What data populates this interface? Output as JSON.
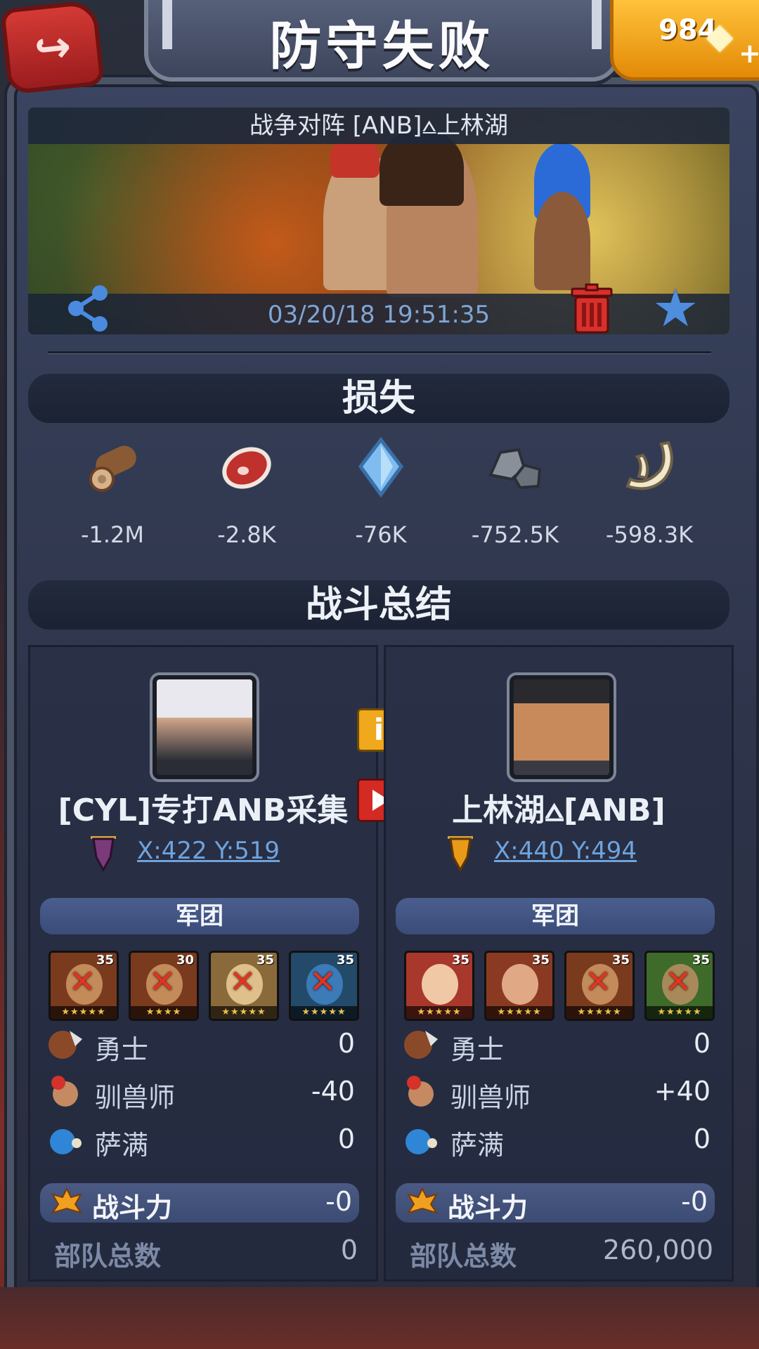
{
  "header": {
    "title": "防守失败",
    "gems": "984",
    "back_icon": "back-arrow-icon",
    "gem_icon": "diamond-icon"
  },
  "battle": {
    "title": "战争对阵 [ANB]⩟上林湖",
    "timestamp": "03/20/18 19:51:35"
  },
  "losses": {
    "title": "损失",
    "items": [
      {
        "icon": "wood-icon",
        "value": "-1.2M"
      },
      {
        "icon": "meat-icon",
        "value": "-2.8K"
      },
      {
        "icon": "crystal-icon",
        "value": "-76K"
      },
      {
        "icon": "stone-icon",
        "value": "-752.5K"
      },
      {
        "icon": "bone-icon",
        "value": "-598.3K"
      }
    ]
  },
  "summary": {
    "title": "战斗总结",
    "left": {
      "name": "[CYL]专打ANB采集",
      "coords": "X:422 Y:519",
      "legion_label": "军团",
      "heroes": [
        {
          "level": "35",
          "stars": "★★★★★",
          "defeated": true
        },
        {
          "level": "30",
          "stars": "★★★★",
          "defeated": true
        },
        {
          "level": "35",
          "stars": "★★★★★",
          "defeated": true
        },
        {
          "level": "35",
          "stars": "★★★★★",
          "defeated": true
        }
      ],
      "units": [
        {
          "name": "勇士",
          "value": "0"
        },
        {
          "name": "驯兽师",
          "value": "-40"
        },
        {
          "name": "萨满",
          "value": "0"
        }
      ],
      "power_label": "战斗力",
      "power_value": "-0",
      "troops_label": "部队总数",
      "troops_value": "0"
    },
    "right": {
      "name": "上林湖⩟[ANB]",
      "coords": "X:440 Y:494",
      "legion_label": "军团",
      "heroes": [
        {
          "level": "35",
          "stars": "★★★★★",
          "defeated": false
        },
        {
          "level": "35",
          "stars": "★★★★★",
          "defeated": false
        },
        {
          "level": "35",
          "stars": "★★★★★",
          "defeated": true
        },
        {
          "level": "35",
          "stars": "★★★★★",
          "defeated": true
        }
      ],
      "units": [
        {
          "name": "勇士",
          "value": "0"
        },
        {
          "name": "驯兽师",
          "value": "+40"
        },
        {
          "name": "萨满",
          "value": "0"
        }
      ],
      "power_label": "战斗力",
      "power_value": "-0",
      "troops_label": "部队总数",
      "troops_value": "260,000"
    }
  },
  "colors": {
    "accent_gold": "#f0a81c",
    "danger_red": "#d42a24",
    "link_blue": "#6fa3dc"
  }
}
